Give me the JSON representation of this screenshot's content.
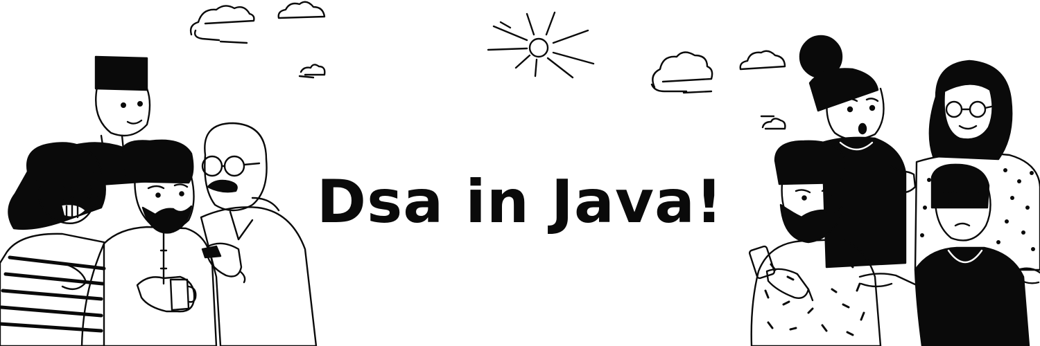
{
  "banner": {
    "title": "Dsa in Java!",
    "colors": {
      "ink": "#0a0a0a",
      "background": "#ffffff"
    },
    "illustrations": [
      "cloud-icon",
      "sun-icon",
      "people-group-left",
      "people-group-right"
    ]
  }
}
